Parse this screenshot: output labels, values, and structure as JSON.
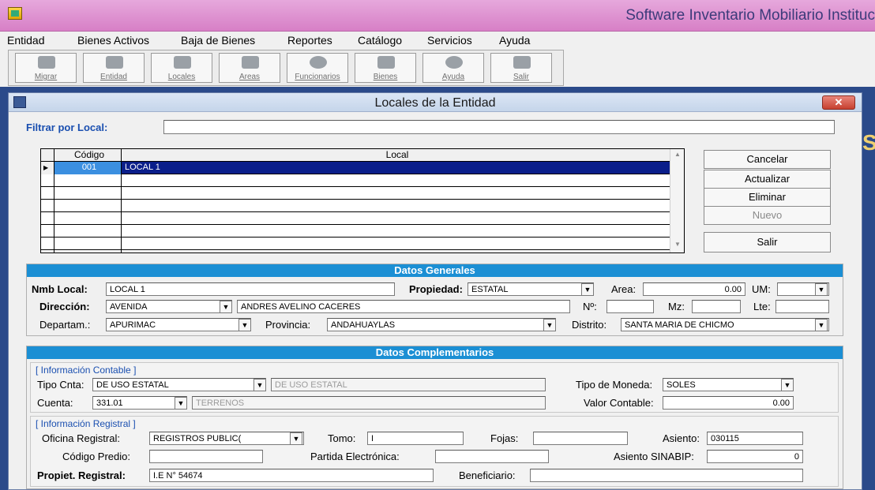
{
  "app": {
    "title": "Software Inventario Mobiliario Instituc"
  },
  "menu": [
    "Entidad",
    "Bienes Activos",
    "Baja de Bienes",
    "Reportes",
    "Catálogo",
    "Servicios",
    "Ayuda"
  ],
  "toolbar": [
    "Migrar",
    "Entidad",
    "Locales",
    "Areas",
    "Funcionarios",
    "Bienes",
    "Ayuda",
    "Salir"
  ],
  "window": {
    "title": "Locales de la Entidad",
    "close_glyph": "✕"
  },
  "filter": {
    "label": "Filtrar por Local:",
    "value": ""
  },
  "grid": {
    "columns": [
      "Código",
      "Local"
    ],
    "rows": [
      {
        "codigo": "001",
        "local": "LOCAL 1"
      }
    ],
    "row_marker": "▶"
  },
  "actions": {
    "cancelar": "Cancelar",
    "actualizar": "Actualizar",
    "eliminar": "Eliminar",
    "nuevo": "Nuevo",
    "salir": "Salir"
  },
  "generales": {
    "header": "Datos Generales",
    "nmb_local": {
      "label": "Nmb Local:",
      "value": "LOCAL 1"
    },
    "propiedad": {
      "label": "Propiedad:",
      "value": "ESTATAL"
    },
    "area": {
      "label": "Area:",
      "value": "0.00"
    },
    "um": {
      "label": "UM:",
      "value": ""
    },
    "direccion": {
      "label": "Dirección:",
      "tipo": "AVENIDA",
      "nombre": "ANDRES AVELINO CACERES"
    },
    "numero": {
      "label": "Nº:",
      "value": ""
    },
    "mz": {
      "label": "Mz:",
      "value": ""
    },
    "lte": {
      "label": "Lte:",
      "value": ""
    },
    "departamento": {
      "label": "Departam.:",
      "value": "APURIMAC"
    },
    "provincia": {
      "label": "Provincia:",
      "value": "ANDAHUAYLAS"
    },
    "distrito": {
      "label": "Distrito:",
      "value": "SANTA MARIA DE CHICMO"
    }
  },
  "complementarios": {
    "header": "Datos Complementarios",
    "contable": {
      "title": "[ Información Contable ]",
      "tipo_cnta": {
        "label": "Tipo Cnta:",
        "value": "DE USO ESTATAL",
        "desc": "DE USO ESTATAL"
      },
      "cuenta": {
        "label": "Cuenta:",
        "value": "331.01",
        "desc": "TERRENOS"
      },
      "tipo_moneda": {
        "label": "Tipo de Moneda:",
        "value": "SOLES"
      },
      "valor_contable": {
        "label": "Valor Contable:",
        "value": "0.00"
      }
    },
    "registral": {
      "title": "[ Información Registral ]",
      "oficina": {
        "label": "Oficina Registral:",
        "value": "REGISTROS PUBLIC("
      },
      "tomo": {
        "label": "Tomo:",
        "value": "I"
      },
      "fojas": {
        "label": "Fojas:",
        "value": ""
      },
      "asiento": {
        "label": "Asiento:",
        "value": "030115"
      },
      "codigo_predio": {
        "label": "Código Predio:",
        "value": ""
      },
      "partida": {
        "label": "Partida Electrónica:",
        "value": ""
      },
      "asiento_sinabip": {
        "label": "Asiento SINABIP:",
        "value": "0"
      },
      "propiet": {
        "label": "Propiet. Registral:",
        "value": "I.E N° 54674"
      },
      "beneficiario": {
        "label": "Beneficiario:",
        "value": ""
      }
    }
  }
}
